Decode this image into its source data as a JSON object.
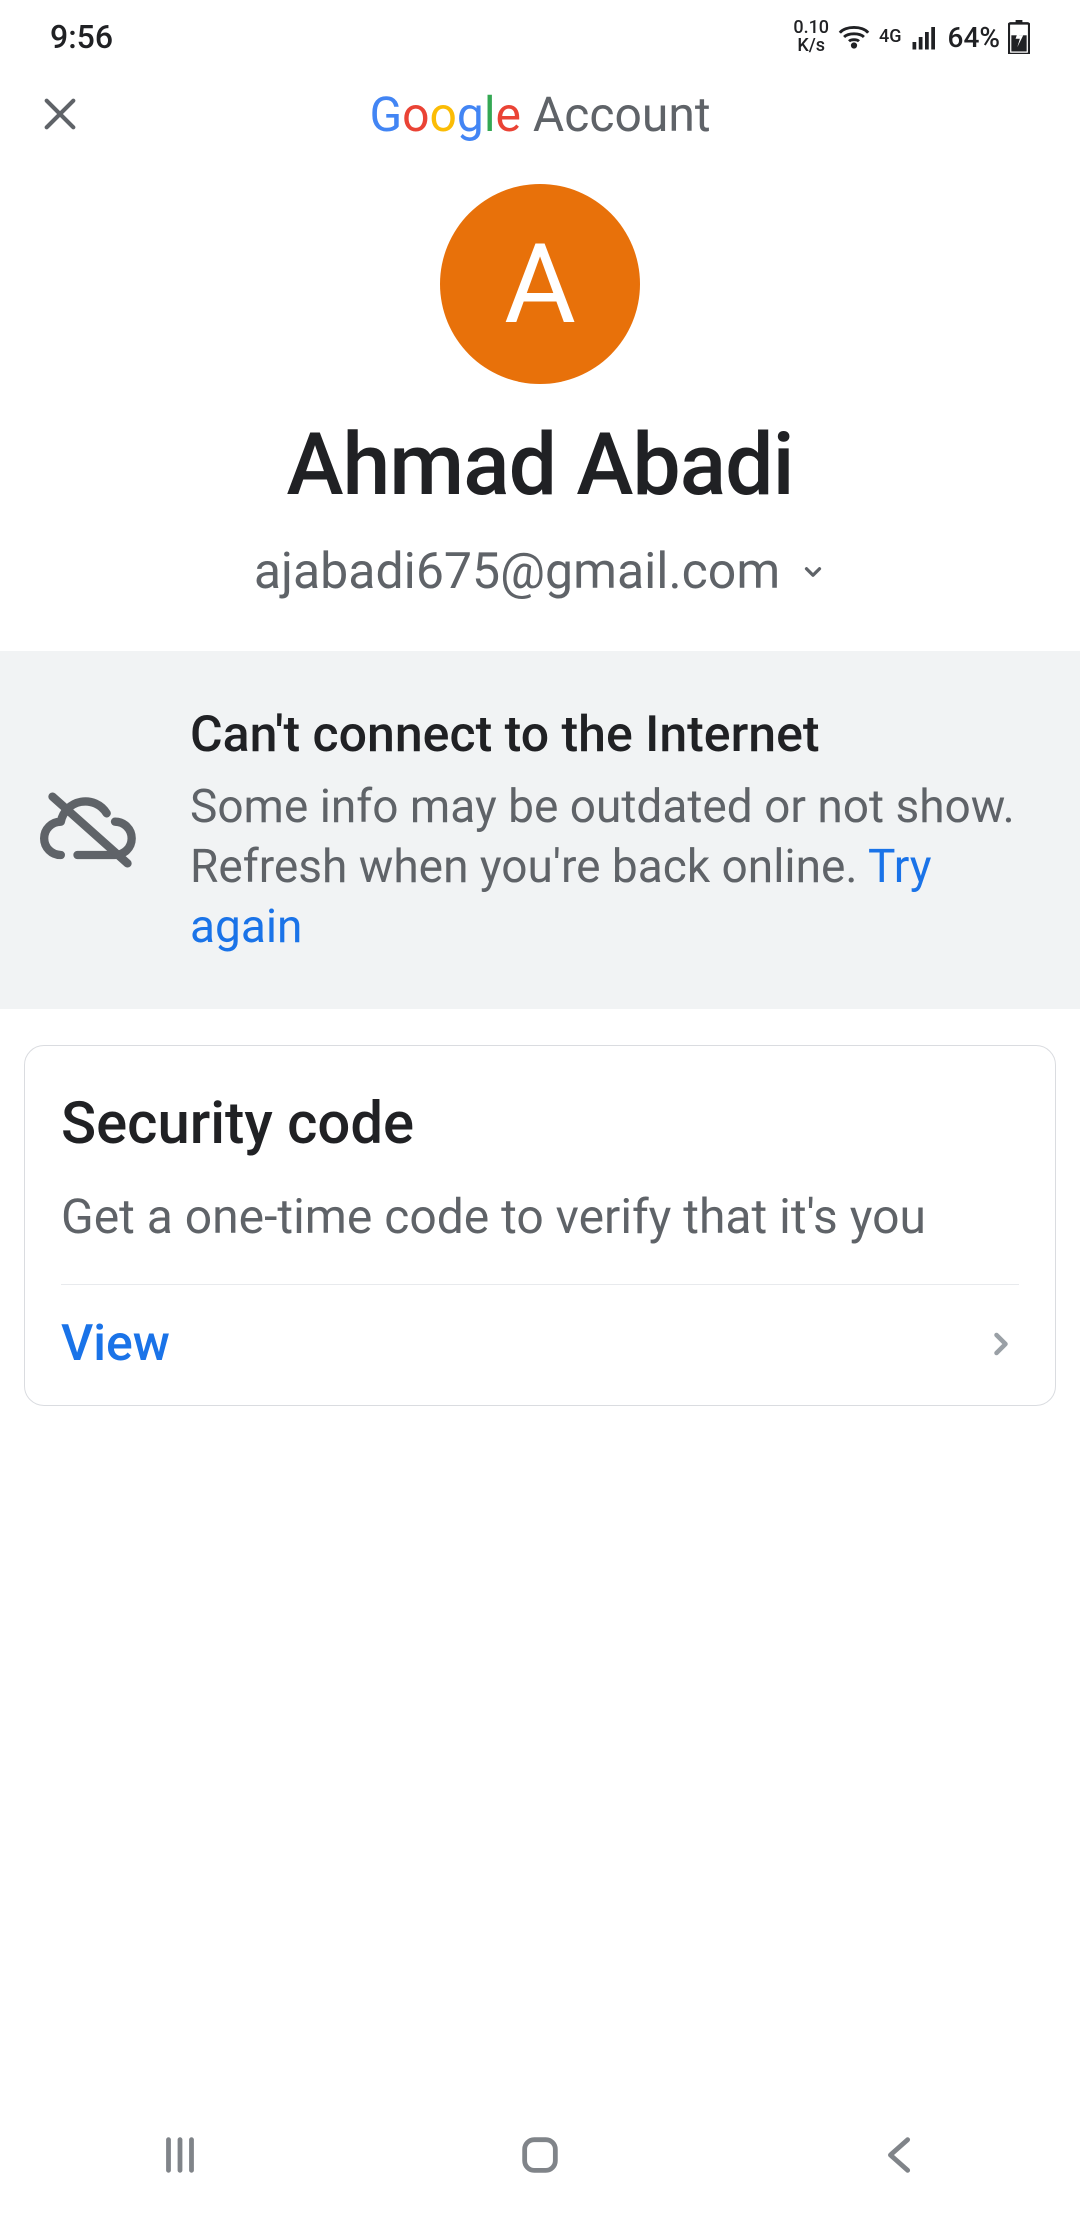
{
  "status_bar": {
    "time": "9:56",
    "net_speed_top": "0.10",
    "net_speed_bottom": "K/s",
    "net_type": "4G",
    "battery_pct": "64%"
  },
  "header": {
    "brand_g1": "G",
    "brand_o1": "o",
    "brand_o2": "o",
    "brand_g2": "g",
    "brand_l": "l",
    "brand_e": "e",
    "brand_rest": " Account"
  },
  "profile": {
    "avatar_letter": "A",
    "display_name": "Ahmad Abadi",
    "email": "ajabadi675@gmail.com"
  },
  "banner": {
    "title": "Can't connect to the Internet",
    "subtitle": "Some info may be outdated or not show. Refresh when you're back online. ",
    "try_again": "Try again"
  },
  "card": {
    "title": "Security code",
    "desc": "Get a one-time code to verify that it's you",
    "action_label": "View"
  }
}
